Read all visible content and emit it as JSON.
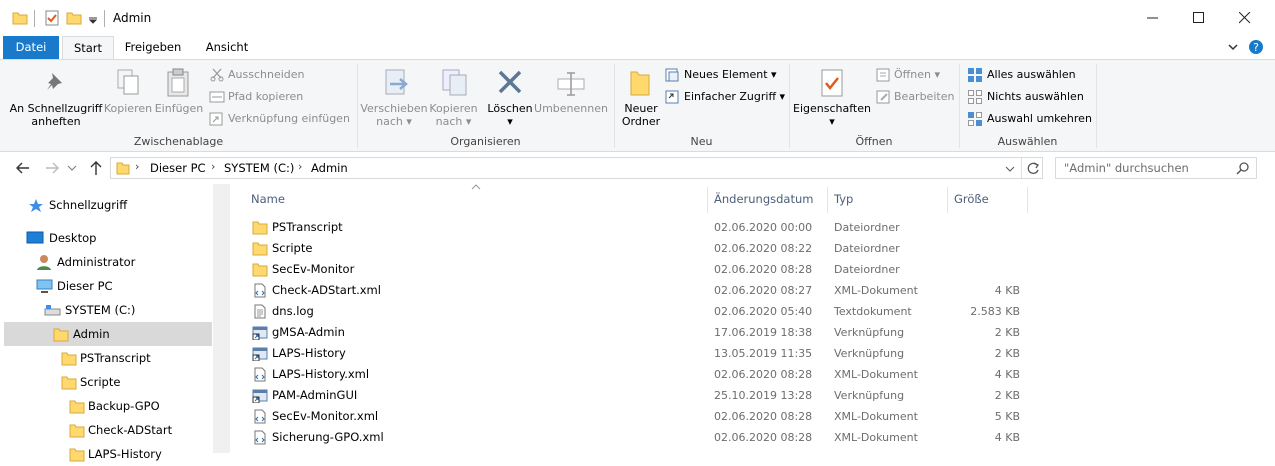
{
  "window": {
    "title": "Admin",
    "minimize": "─",
    "maximize": "☐",
    "close": "✕"
  },
  "ribbon_tabs": [
    "Datei",
    "Start",
    "Freigeben",
    "Ansicht"
  ],
  "ribbon": {
    "zwischenablage": {
      "label": "Zwischenablage",
      "pin": "An Schnellzugriff anheften",
      "copy": "Kopieren",
      "paste": "Einfügen",
      "cut": "Ausschneiden",
      "copy_path": "Pfad kopieren",
      "paste_shortcut": "Verknüpfung einfügen"
    },
    "organisieren": {
      "label": "Organisieren",
      "move_to": "Verschieben nach",
      "copy_to": "Kopieren nach",
      "delete": "Löschen",
      "rename": "Umbenennen"
    },
    "neu": {
      "label": "Neu",
      "new_folder": "Neuer Ordner",
      "new_item": "Neues Element",
      "easy_access": "Einfacher Zugriff"
    },
    "oeffnen": {
      "label": "Öffnen",
      "properties": "Eigenschaften",
      "open": "Öffnen",
      "edit": "Bearbeiten"
    },
    "auswaehlen": {
      "label": "Auswählen",
      "select_all": "Alles auswählen",
      "select_none": "Nichts auswählen",
      "invert": "Auswahl umkehren"
    }
  },
  "address": {
    "crumbs": [
      "Dieser PC",
      "SYSTEM (C:)",
      "Admin"
    ],
    "search_placeholder": "\"Admin\" durchsuchen"
  },
  "nav": {
    "quick": "Schnellzugriff",
    "desktop": "Desktop",
    "administrator": "Administrator",
    "pc": "Dieser PC",
    "drive": "SYSTEM (C:)",
    "admin": "Admin",
    "pstranscript": "PSTranscript",
    "scripte": "Scripte",
    "backup": "Backup-GPO",
    "check": "Check-ADStart",
    "laps": "LAPS-History"
  },
  "columns": {
    "name": "Name",
    "date": "Änderungsdatum",
    "type": "Typ",
    "size": "Größe"
  },
  "files": [
    {
      "name": "PSTranscript",
      "date": "02.06.2020 00:00",
      "type": "Dateiordner",
      "size": "",
      "icon": "folder-icon"
    },
    {
      "name": "Scripte",
      "date": "02.06.2020 08:22",
      "type": "Dateiordner",
      "size": "",
      "icon": "folder-icon"
    },
    {
      "name": "SecEv-Monitor",
      "date": "02.06.2020 08:28",
      "type": "Dateiordner",
      "size": "",
      "icon": "folder-icon"
    },
    {
      "name": "Check-ADStart.xml",
      "date": "02.06.2020 08:27",
      "type": "XML-Dokument",
      "size": "4 KB",
      "icon": "xml-file-icon"
    },
    {
      "name": "dns.log",
      "date": "02.06.2020 05:40",
      "type": "Textdokument",
      "size": "2.583 KB",
      "icon": "text-file-icon"
    },
    {
      "name": "gMSA-Admin",
      "date": "17.06.2019 18:38",
      "type": "Verknüpfung",
      "size": "2 KB",
      "icon": "shortcut-icon"
    },
    {
      "name": "LAPS-History",
      "date": "13.05.2019 11:35",
      "type": "Verknüpfung",
      "size": "2 KB",
      "icon": "shortcut-icon"
    },
    {
      "name": "LAPS-History.xml",
      "date": "02.06.2020 08:28",
      "type": "XML-Dokument",
      "size": "4 KB",
      "icon": "xml-file-icon"
    },
    {
      "name": "PAM-AdminGUI",
      "date": "25.10.2019 13:28",
      "type": "Verknüpfung",
      "size": "2 KB",
      "icon": "shortcut-icon"
    },
    {
      "name": "SecEv-Monitor.xml",
      "date": "02.06.2020 08:28",
      "type": "XML-Dokument",
      "size": "5 KB",
      "icon": "xml-file-icon"
    },
    {
      "name": "Sicherung-GPO.xml",
      "date": "02.06.2020 08:28",
      "type": "XML-Dokument",
      "size": "4 KB",
      "icon": "xml-file-icon"
    }
  ],
  "colors": {
    "accent": "#1979ca",
    "folder": "#ffd86e",
    "selected": "#d9d9d9"
  }
}
